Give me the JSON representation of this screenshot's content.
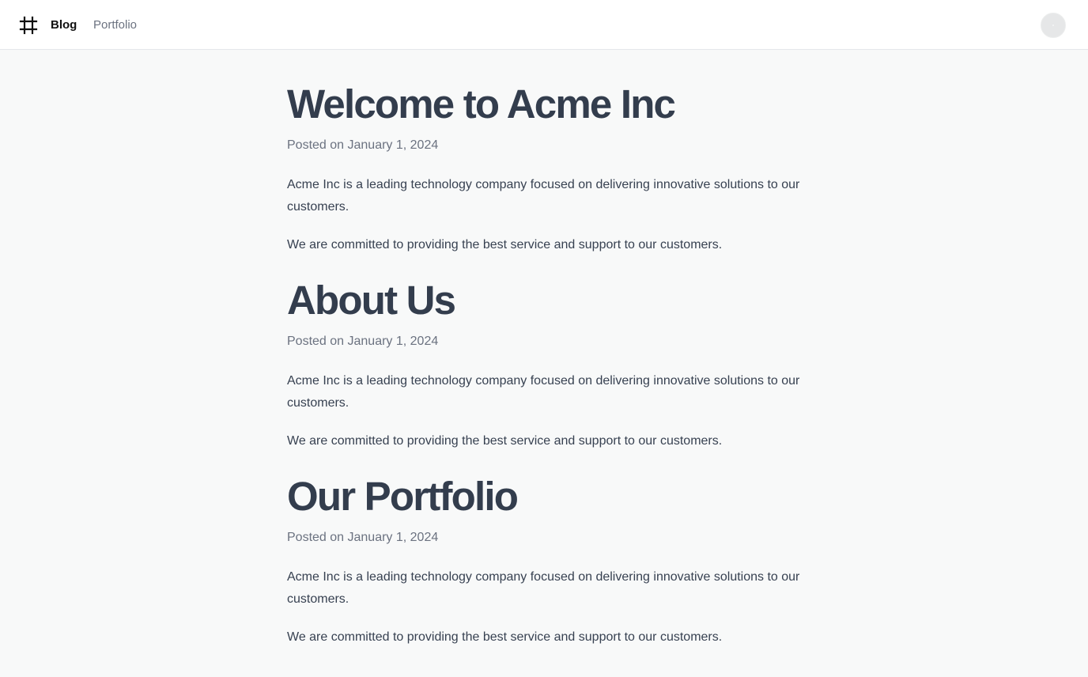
{
  "nav": {
    "logo_icon": "hashtag-icon",
    "links": [
      {
        "label": "Blog"
      },
      {
        "label": "Portfolio"
      }
    ],
    "avatar_icon": "user-avatar"
  },
  "colors": {
    "page_background": "#f8f9f9",
    "header_background": "#ffffff",
    "heading": "#333d4d",
    "body_text": "#374151",
    "muted_text": "#6b7280"
  },
  "articles": [
    {
      "title": "Welcome to Acme Inc",
      "date": "Posted on January 1, 2024",
      "paragraphs": [
        "Acme Inc is a leading technology company focused on delivering innovative solutions to our customers.",
        "We are committed to providing the best service and support to our customers."
      ]
    },
    {
      "title": "About Us",
      "date": "Posted on January 1, 2024",
      "paragraphs": [
        "Acme Inc is a leading technology company focused on delivering innovative solutions to our customers.",
        "We are committed to providing the best service and support to our customers."
      ]
    },
    {
      "title": "Our Portfolio",
      "date": "Posted on January 1, 2024",
      "paragraphs": [
        "Acme Inc is a leading technology company focused on delivering innovative solutions to our customers.",
        "We are committed to providing the best service and support to our customers."
      ]
    }
  ]
}
